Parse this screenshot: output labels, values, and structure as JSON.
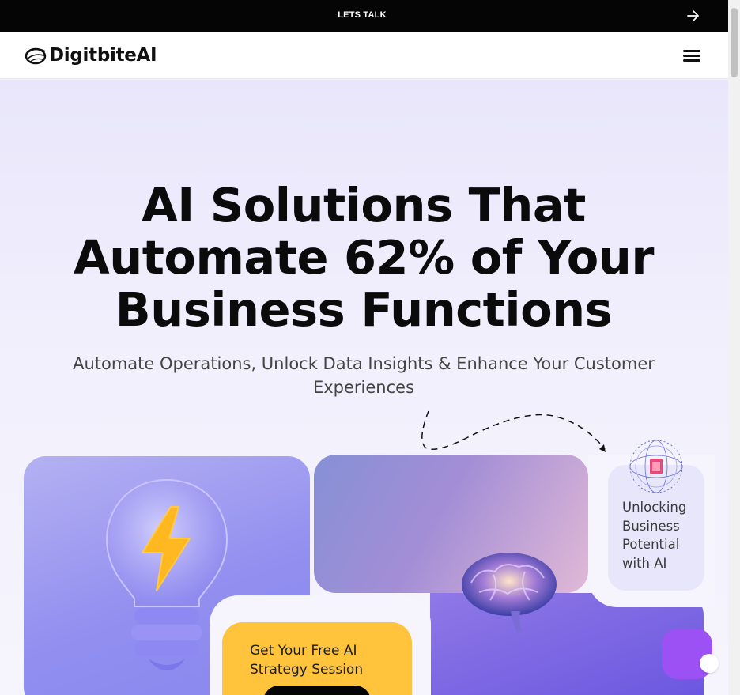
{
  "topbar": {
    "cta_label": "LETS TALK",
    "icon": "arrow-right-icon"
  },
  "header": {
    "brand": "DigitbiteAI",
    "menu_icon": "hamburger-menu-icon"
  },
  "hero": {
    "title": "AI Solutions That Automate 62% of Your Business Functions",
    "subtitle": "Automate Operations, Unlock Data Insights & Enhance Your Customer Experiences"
  },
  "cards": {
    "side_card_text": "Unlocking Business Potential with AI",
    "promo_text": "Get Your Free AI Strategy Session"
  },
  "colors": {
    "accent_purple": "#9b51f3",
    "promo_yellow": "#ffc43c",
    "bulb_card": "#928ff0",
    "hero_bg": "#ece9fb"
  },
  "icons": [
    "arrow-right-icon",
    "logo-swirl-icon",
    "hamburger-menu-icon",
    "lightbulb-icon",
    "lightning-icon",
    "brain-icon",
    "ai-globe-icon",
    "chat-bubble-icon"
  ]
}
